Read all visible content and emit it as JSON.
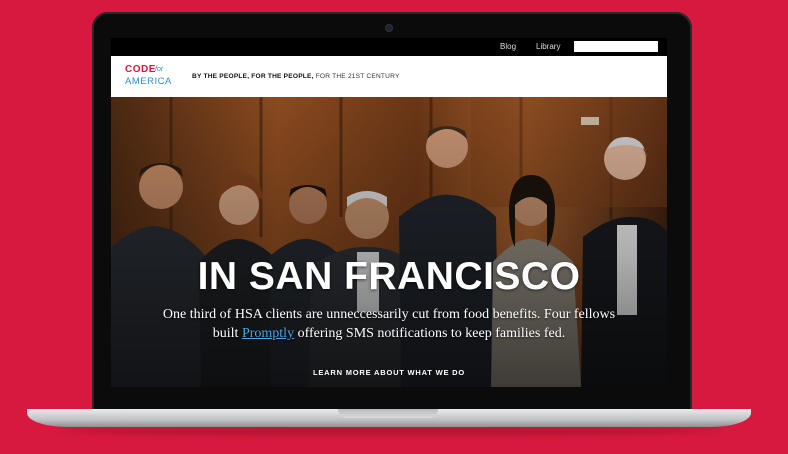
{
  "nav": {
    "blog_label": "Blog",
    "library_label": "Library",
    "search_placeholder": ""
  },
  "header": {
    "logo_line1": "CODE",
    "logo_for": "for",
    "logo_line2": "AMERICA",
    "tagline_bold": "BY THE PEOPLE, FOR THE PEOPLE,",
    "tagline_light": " FOR THE 21ST CENTURY"
  },
  "hero": {
    "headline": "IN SAN FRANCISCO",
    "body_before": "One third of HSA clients are unneccessarily cut from food benefits. Four fellows built ",
    "body_link": "Promptly",
    "body_after": " offering SMS notifications to keep families fed.",
    "cta": "LEARN MORE ABOUT WHAT WE DO"
  },
  "colors": {
    "background": "#d7193f",
    "brand_red": "#d7193f",
    "brand_blue": "#2e8ed0",
    "link_blue": "#4aa6e8"
  },
  "icons": [
    "webcam-icon"
  ]
}
